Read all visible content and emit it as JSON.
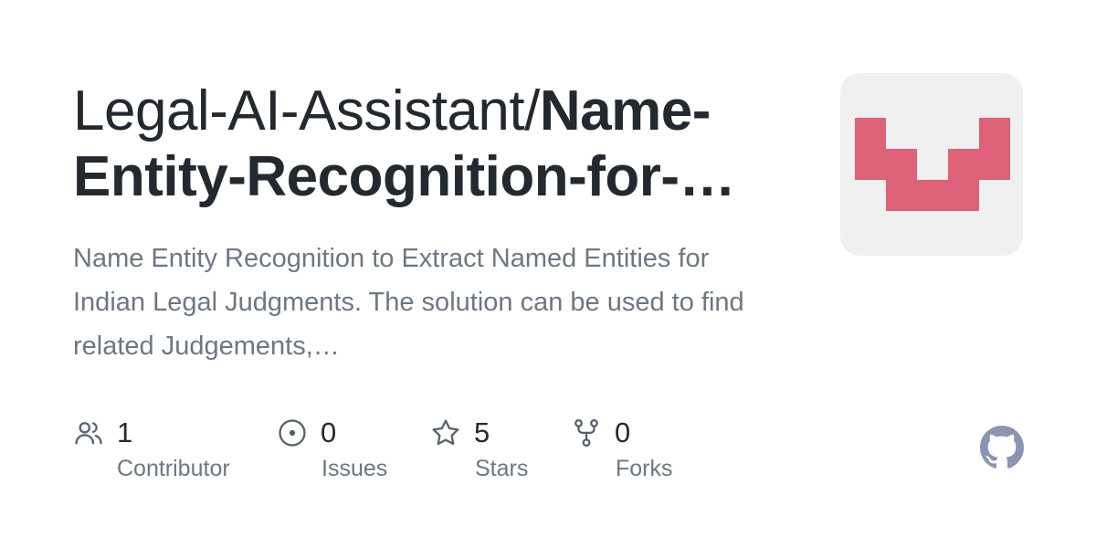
{
  "repo": {
    "owner": "Legal-AI-Assistant/",
    "name_line1": "Name-",
    "name_line2": "Entity-Recognition-for-…",
    "description": "Name Entity Recognition to Extract Named Entities for Indian Legal Judgments. The solution can be used to find related Judgements,…"
  },
  "stats": {
    "contributors": {
      "value": "1",
      "label": "Contributor",
      "icon": "people-icon"
    },
    "issues": {
      "value": "0",
      "label": "Issues",
      "icon": "issue-opened-icon"
    },
    "stars": {
      "value": "5",
      "label": "Stars",
      "icon": "star-icon"
    },
    "forks": {
      "value": "0",
      "label": "Forks",
      "icon": "repo-forked-icon"
    }
  },
  "colors": {
    "title": "#24292f",
    "muted": "#6e7781",
    "icon": "#57606a",
    "avatar_bg": "#f0f0f0",
    "avatar_mark": "#dd6177",
    "github_logo": "#8b95b1"
  },
  "icons": {
    "avatar": "identicon",
    "brand": "github-mark-icon"
  }
}
